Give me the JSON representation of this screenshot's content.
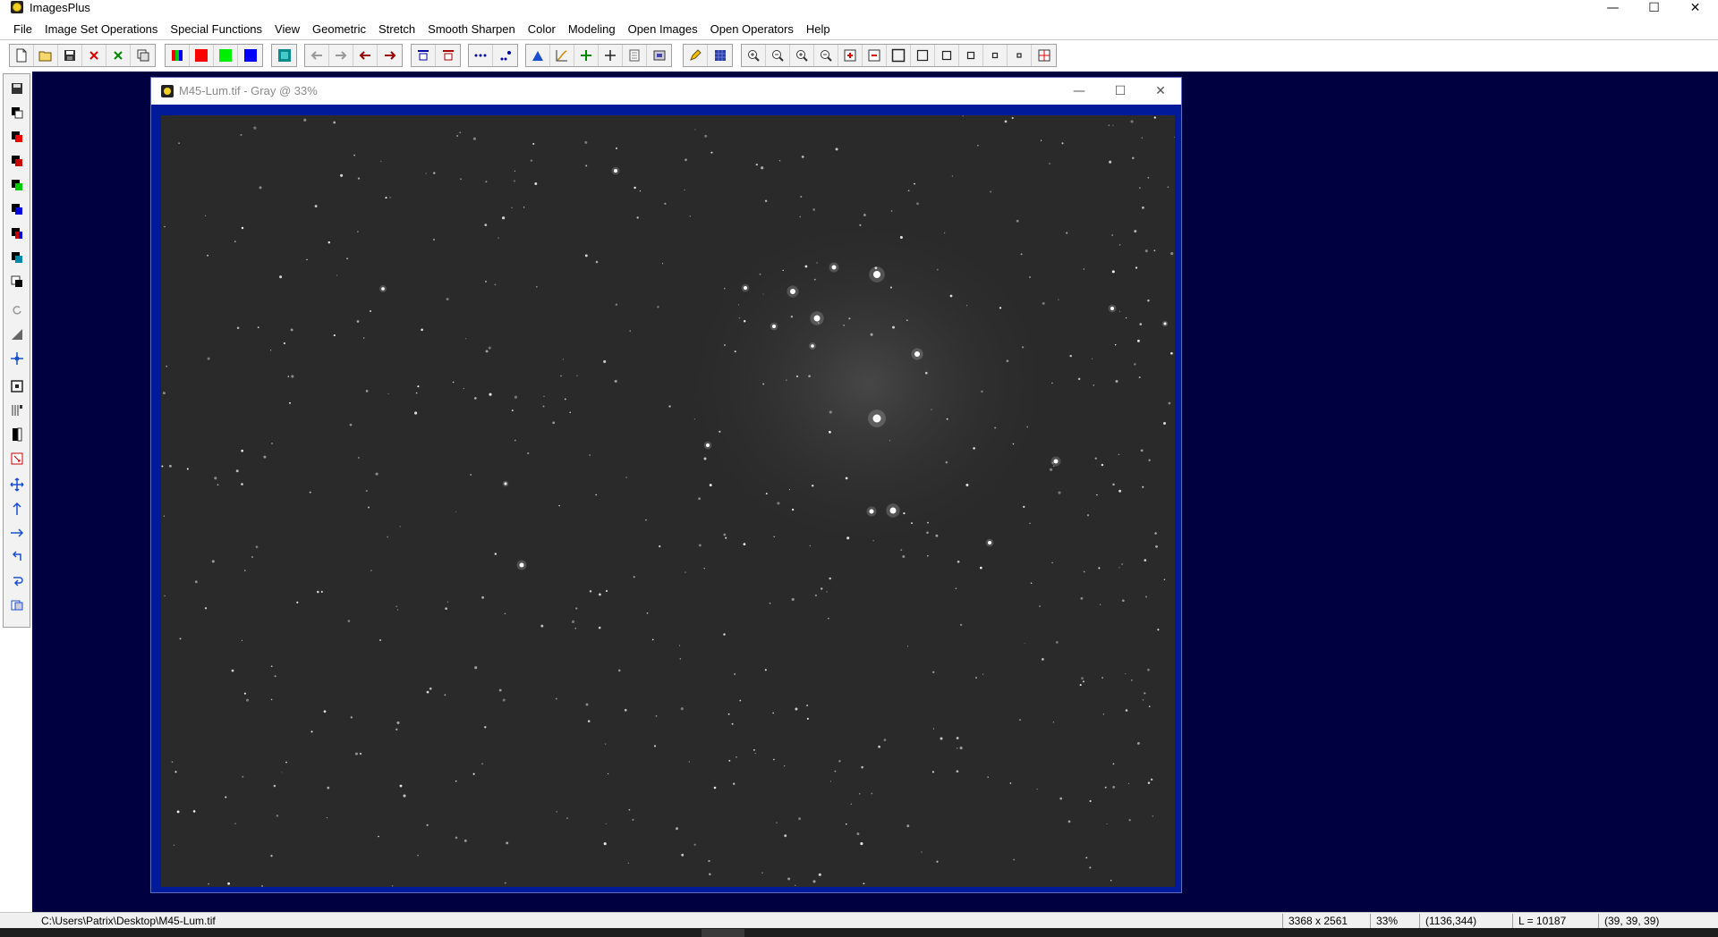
{
  "app": {
    "title": "ImagesPlus",
    "minimize": "—",
    "maximize": "☐",
    "close": "✕"
  },
  "menu": [
    "File",
    "Image Set Operations",
    "Special Functions",
    "View",
    "Geometric",
    "Stretch",
    "Smooth Sharpen",
    "Color",
    "Modeling",
    "Open Images",
    "Open Operators",
    "Help"
  ],
  "toolbar_icons": [
    "new-file-icon",
    "open-folder-icon",
    "save-icon",
    "close-red-x-icon",
    "close-green-x-icon",
    "copy-window-icon",
    "rgb-channels-icon",
    "red-channel-icon",
    "green-channel-icon",
    "blue-channel-icon",
    "teal-square-icon",
    "arrow-left-gray-icon",
    "arrow-right-gray-icon",
    "arrow-left-red-icon",
    "arrow-right-red-icon",
    "stack-top-icon",
    "stack-bottom-icon",
    "dots-line-icon",
    "dots-pixel-icon",
    "histogram-icon",
    "curves-icon",
    "crosshair-green-icon",
    "crosshair-black-icon",
    "grid-icon",
    "frame-icon",
    "pencil-icon",
    "blue-grid-icon",
    "zoom-in-icon",
    "zoom-out-icon",
    "zoom-fit-icon",
    "zoom-out-2-icon",
    "plus-box-icon",
    "minus-box-icon",
    "square-large-icon",
    "square-medium-icon",
    "square-small-icon",
    "square-xsmall-icon",
    "square-tiny-icon",
    "square-dot-icon",
    "crosshair-box-icon"
  ],
  "image_window": {
    "title": "M45-Lum.tif - Gray @ 33%",
    "minimize": "—",
    "maximize": "☐",
    "close": "✕"
  },
  "status": {
    "path": "C:\\Users\\Patrix\\Desktop\\M45-Lum.tif",
    "dimensions": "3368 x 2561",
    "zoom": "33%",
    "cursor": "(1136,344)",
    "luminance": "L = 10187",
    "rgb": "(39, 39, 39)"
  },
  "colors": {
    "workspace": "#000040",
    "image_frame": "#001a99",
    "image_background": "#2a2a2a"
  }
}
